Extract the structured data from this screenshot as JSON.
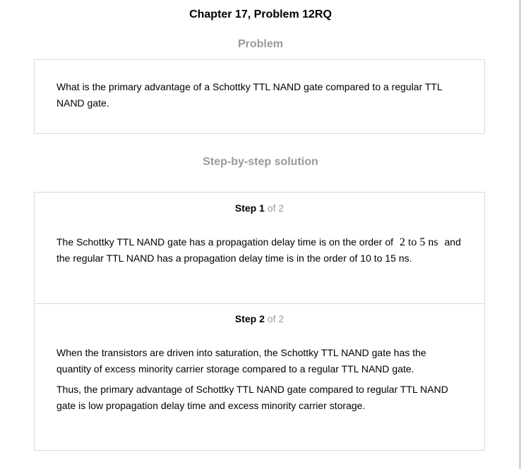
{
  "chapter_title": "Chapter 17, Problem 12RQ",
  "problem": {
    "heading": "Problem",
    "text": "What is the primary advantage of a Schottky TTL NAND gate compared to a regular TTL NAND gate."
  },
  "solution": {
    "heading": "Step-by-step solution",
    "steps": [
      {
        "step_word": "Step",
        "number": "1",
        "of": "of 2",
        "text_before": "The Schottky TTL NAND gate has a propagation delay time is on the order of",
        "math": "2 to 5 ns",
        "text_after": "and the regular TTL NAND has a propagation delay time is in the order of 10 to 15 ns."
      },
      {
        "step_word": "Step",
        "number": "2",
        "of": "of 2",
        "para1": "When the transistors are driven into saturation, the Schottky TTL NAND gate has the quantity of excess minority carrier storage compared to a regular TTL NAND gate.",
        "para2": "Thus, the primary advantage of Schottky TTL NAND gate compared to regular TTL NAND gate is low propagation delay time and excess minority carrier storage."
      }
    ]
  }
}
